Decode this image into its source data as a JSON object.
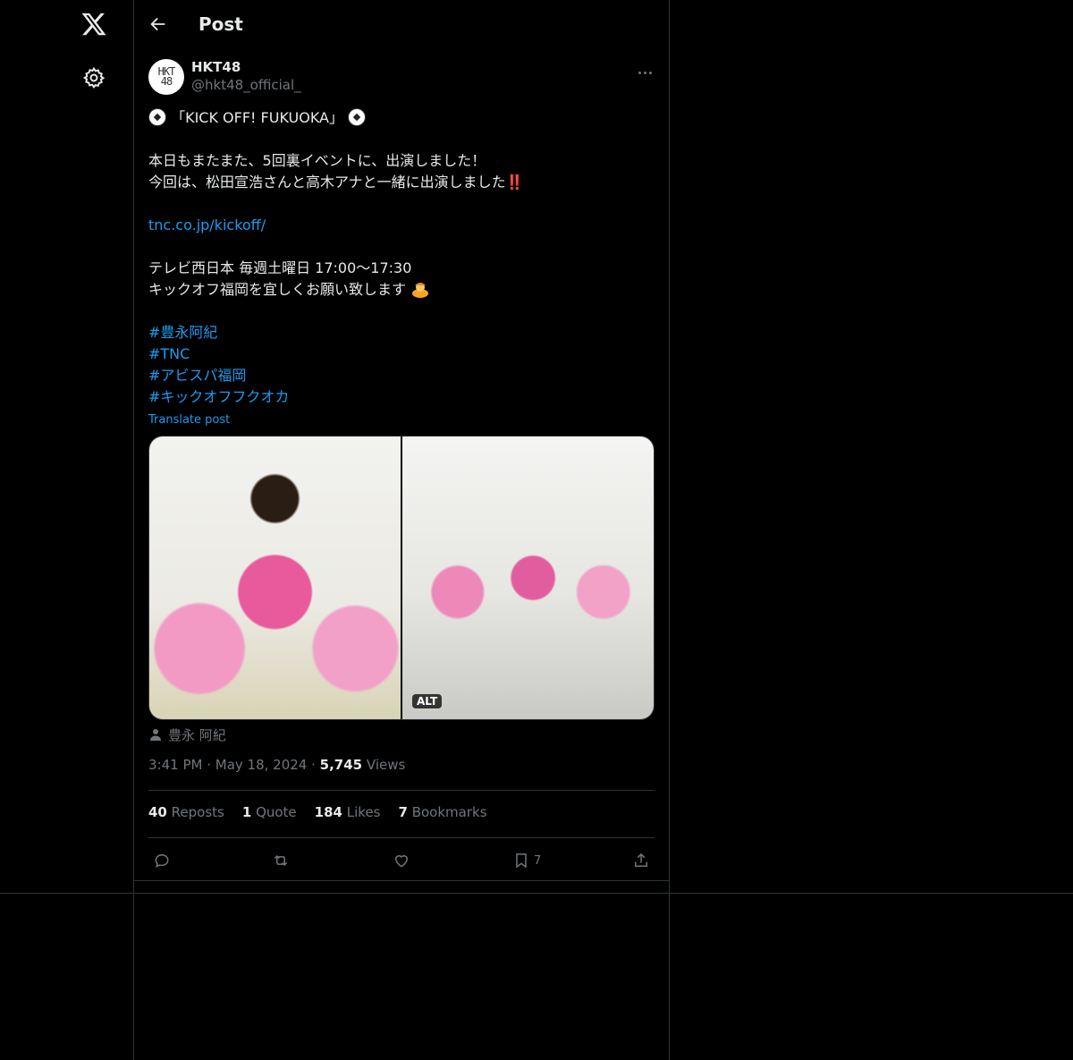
{
  "nav": {
    "logo": "x-logo-icon",
    "settings": "gear-icon"
  },
  "header": {
    "title": "Post"
  },
  "post": {
    "author": {
      "name": "HKT48",
      "handle": "@hkt48_official_",
      "avatar_text": "HKT\n48"
    },
    "lines": {
      "l1": "「KICK OFF! FUKUOKA」",
      "l2": "本日もまたまた、5回裏イベントに、出演しました！",
      "l3": "今回は、松田宣浩さんと高木アナと一緒に出演しました",
      "l3_bang": "‼️",
      "link": "tnc.co.jp/kickoff/",
      "l4": "テレビ西日本 毎週土曜日 17:00〜17:30",
      "l5": "キックオフ福岡を宜しくお願い致します",
      "h1": "#豊永阿紀",
      "h2": "#TNC",
      "h3": "#アビスパ福岡",
      "h4": "#キックオフフクオカ"
    },
    "translate": "Translate post",
    "alt_badge": "ALT",
    "tagged_user": "豊永 阿紀",
    "time": "3:41 PM",
    "date": "May 18, 2024",
    "views_count": "5,745",
    "views_label": "Views",
    "stats": {
      "reposts": "40",
      "reposts_label": "Reposts",
      "quotes": "1",
      "quotes_label": "Quote",
      "likes": "184",
      "likes_label": "Likes",
      "bookmarks": "7",
      "bookmarks_label": "Bookmarks"
    },
    "actions": {
      "bookmark_count": "7"
    }
  },
  "colors": {
    "background": "#000000",
    "text": "#e7e9ea",
    "muted": "#71767b",
    "link": "#1d9bf0",
    "border": "#2f3336"
  }
}
